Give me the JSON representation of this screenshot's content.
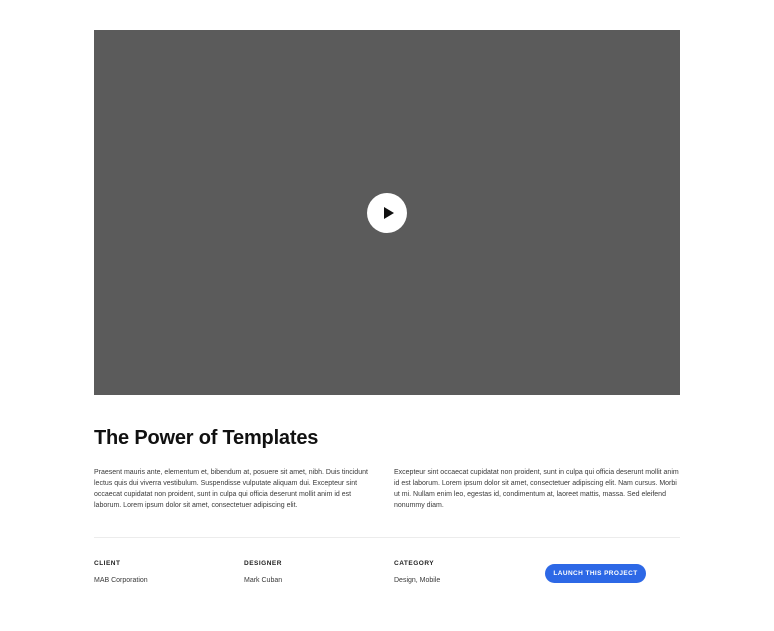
{
  "project": {
    "title": "The Power of Templates",
    "description_left": "Praesent mauris ante, elementum et, bibendum at, posuere sit amet, nibh. Duis tincidunt lectus quis dui viverra vestibulum. Suspendisse vulputate aliquam dui. Excepteur sint occaecat cupidatat non proident, sunt in culpa qui officia deserunt mollit anim id est laborum. Lorem ipsum dolor sit amet, consectetuer adipiscing elit.",
    "description_right": "Excepteur sint occaecat cupidatat non proident, sunt in culpa qui officia deserunt mollit anim id est laborum. Lorem ipsum dolor sit amet, consectetuer adipiscing elit. Nam cursus. Morbi ut mi. Nullam enim leo, egestas id, condimentum at, laoreet mattis, massa. Sed eleifend nonummy diam."
  },
  "video": {
    "background_color": "#5b5b5b",
    "play_icon": "play-icon"
  },
  "meta": {
    "client_label": "CLIENT",
    "client_value": "MAB Corporation",
    "designer_label": "DESIGNER",
    "designer_value": "Mark Cuban",
    "category_label": "CATEGORY",
    "category_value": "Design, Mobile"
  },
  "actions": {
    "launch_label": "LAUNCH THIS PROJECT",
    "accent_color": "#2d68e6"
  }
}
